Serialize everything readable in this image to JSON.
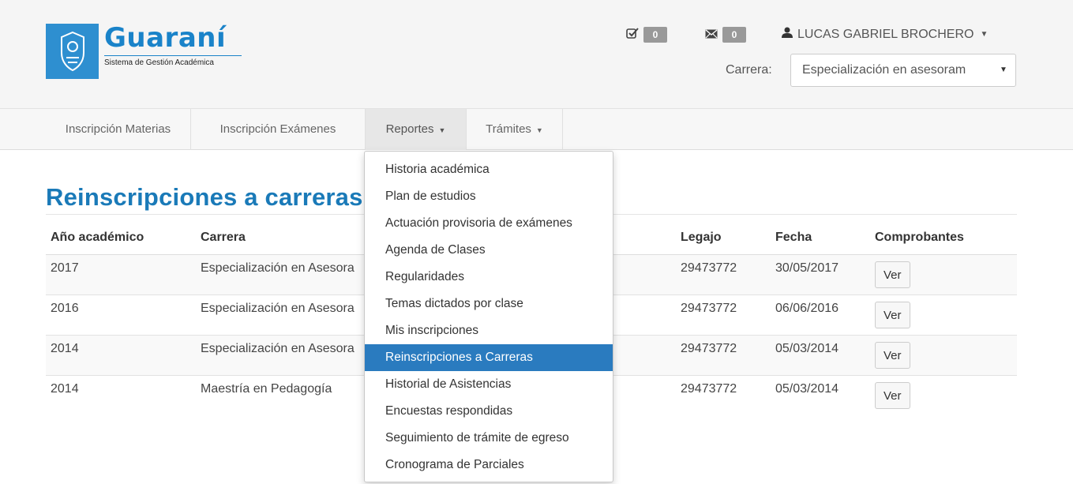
{
  "brand": {
    "title": "Guaraní",
    "subtitle": "Sistema de Gestión Académica"
  },
  "header": {
    "tasks_count": "0",
    "messages_count": "0",
    "user_name": "LUCAS GABRIEL BROCHERO",
    "carrera_label": "Carrera:",
    "carrera_value": "Especialización en asesoram"
  },
  "nav": {
    "items": [
      {
        "label": "Inscripción Materias"
      },
      {
        "label": "Inscripción Exámenes"
      },
      {
        "label": "Reportes"
      },
      {
        "label": "Trámites"
      }
    ]
  },
  "dropdown": {
    "items": [
      {
        "label": "Historia académica"
      },
      {
        "label": "Plan de estudios"
      },
      {
        "label": "Actuación provisoria de exámenes"
      },
      {
        "label": "Agenda de Clases"
      },
      {
        "label": "Regularidades"
      },
      {
        "label": "Temas dictados por clase"
      },
      {
        "label": "Mis inscripciones"
      },
      {
        "label": "Reinscripciones a Carreras"
      },
      {
        "label": "Historial de Asistencias"
      },
      {
        "label": "Encuestas respondidas"
      },
      {
        "label": "Seguimiento de trámite de egreso"
      },
      {
        "label": "Cronograma de Parciales"
      }
    ],
    "active_index": 7
  },
  "main": {
    "title": "Reinscripciones a carreras",
    "columns": [
      "Año académico",
      "Carrera",
      "Legajo",
      "Fecha",
      "Comprobantes"
    ],
    "rows": [
      {
        "anio": "2017",
        "carrera": "Especialización en Asesora",
        "legajo": "29473772",
        "fecha": "30/05/2017",
        "btn": "Ver"
      },
      {
        "anio": "2016",
        "carrera": "Especialización en Asesora",
        "legajo": "29473772",
        "fecha": "06/06/2016",
        "btn": "Ver"
      },
      {
        "anio": "2014",
        "carrera": "Especialización en Asesora",
        "legajo": "29473772",
        "fecha": "05/03/2014",
        "btn": "Ver"
      },
      {
        "anio": "2014",
        "carrera": "Maestría en Pedagogía",
        "legajo": "29473772",
        "fecha": "05/03/2014",
        "btn": "Ver"
      }
    ]
  },
  "colors": {
    "accent": "#1a7ab8",
    "menu_active": "#2a7bbf"
  }
}
